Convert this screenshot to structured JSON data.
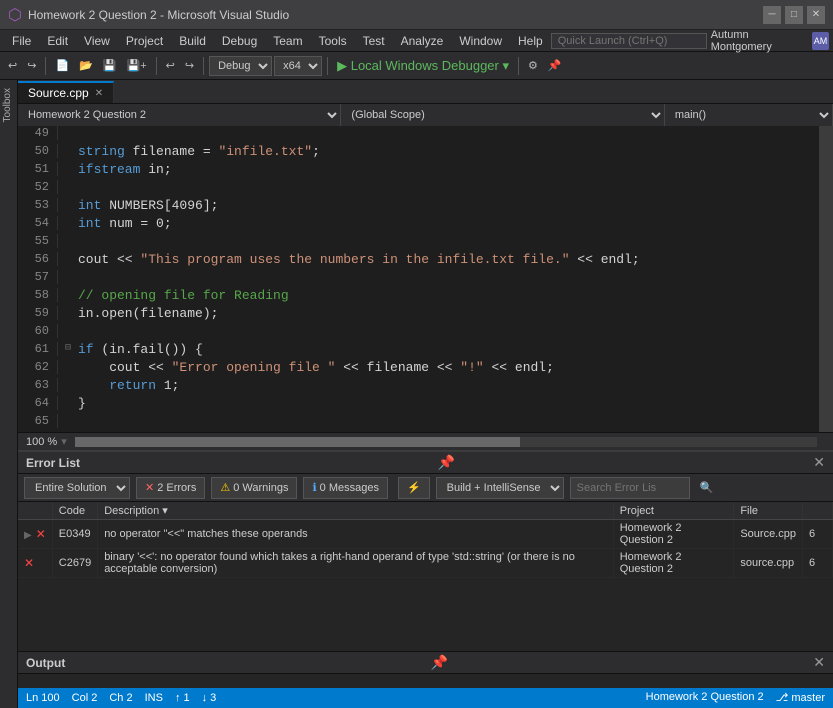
{
  "titlebar": {
    "title": "Homework 2 Question 2 - Microsoft Visual Studio",
    "icon": "⬡"
  },
  "menubar": {
    "items": [
      "File",
      "Edit",
      "View",
      "Project",
      "Build",
      "Debug",
      "Team",
      "Tools",
      "Test",
      "Analyze",
      "Window",
      "Help"
    ],
    "search_placeholder": "Quick Launch (Ctrl+Q)",
    "user": "Autumn Montgomery",
    "user_initials": "AM"
  },
  "toolbar": {
    "debug_config": "Debug",
    "platform": "x64",
    "run_label": "▶ Local Windows Debugger"
  },
  "editor": {
    "tab_label": "Source.cpp",
    "breadcrumb_project": "Homework 2 Question 2",
    "breadcrumb_scope": "(Global Scope)",
    "breadcrumb_func": "main()",
    "lines": [
      {
        "num": 49,
        "indent": 2,
        "content": ""
      },
      {
        "num": 50,
        "indent": 2,
        "content": "string filename = \"infile.txt\";"
      },
      {
        "num": 51,
        "indent": 2,
        "content": "ifstream in;"
      },
      {
        "num": 52,
        "indent": 2,
        "content": ""
      },
      {
        "num": 53,
        "indent": 2,
        "content": "int NUMBERS[4096];"
      },
      {
        "num": 54,
        "indent": 2,
        "content": "int num = 0;"
      },
      {
        "num": 55,
        "indent": 2,
        "content": ""
      },
      {
        "num": 56,
        "indent": 2,
        "content": "cout << \"This program uses the numbers in the infile.txt file.\" << endl;"
      },
      {
        "num": 57,
        "indent": 2,
        "content": ""
      },
      {
        "num": 58,
        "indent": 2,
        "content": "// opening file for Reading"
      },
      {
        "num": 59,
        "indent": 2,
        "content": "in.open(filename);"
      },
      {
        "num": 60,
        "indent": 2,
        "content": ""
      },
      {
        "num": 61,
        "indent": 2,
        "content": "if (in.fail()) {"
      },
      {
        "num": 62,
        "indent": 3,
        "content": "cout << \"Error opening file \" << filename << \"!\" << endl;"
      },
      {
        "num": 63,
        "indent": 3,
        "content": "return 1;"
      },
      {
        "num": 64,
        "indent": 2,
        "content": "}"
      },
      {
        "num": 65,
        "indent": 0,
        "content": ""
      }
    ],
    "zoom": "100 %"
  },
  "error_panel": {
    "title": "Error List",
    "solution_label": "Entire Solution",
    "errors_btn": "2 Errors",
    "warnings_btn": "0 Warnings",
    "messages_btn": "0 Messages",
    "build_filter": "Build + IntelliSense",
    "search_placeholder": "Search Error Lis",
    "columns": [
      "",
      "Code",
      "Description",
      "Project",
      "File",
      ""
    ],
    "rows": [
      {
        "expand": "▶",
        "icon": "error",
        "code": "E0349",
        "description": "no operator \"<<\" matches these operands",
        "project": "Homework 2 Question 2",
        "file": "Source.cpp",
        "line": "6"
      },
      {
        "expand": "",
        "icon": "error",
        "code": "C2679",
        "description": "binary '<<': no operator found which takes a right-hand operand of type 'std::string' (or there is no acceptable conversion)",
        "project": "Homework 2 Question 2",
        "file": "source.cpp",
        "line": "6"
      }
    ]
  },
  "output_panel": {
    "title": "Output"
  },
  "statusbar": {
    "ln": "Ln 100",
    "col": "Col 2",
    "ch": "Ch 2",
    "ins": "INS",
    "arrow_up": "↑ 1",
    "arrow_down": "↓ 3",
    "project": "Homework 2 Question 2",
    "branch": "⎇ master"
  }
}
